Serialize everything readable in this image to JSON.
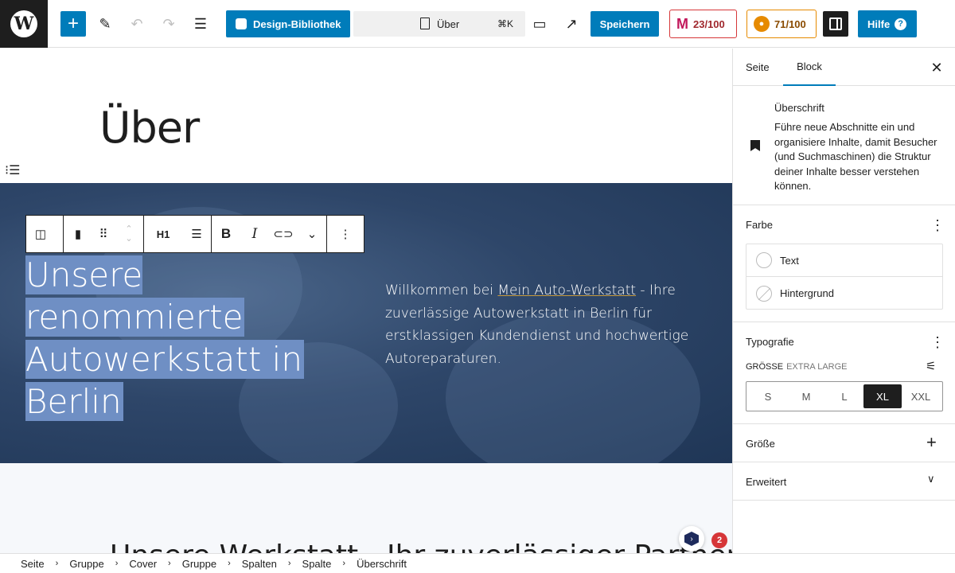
{
  "toolbar": {
    "design_library_label": "Design-Bibliothek",
    "doc_title": "Über",
    "shortcut": "⌘K",
    "save_label": "Speichern",
    "score_a": "23/100",
    "score_b": "71/100",
    "help_label": "Hilfe",
    "colors": {
      "accent": "#007cba",
      "score_a": "#d63638",
      "score_b": "#e68a00"
    }
  },
  "canvas": {
    "page_title": "Über",
    "cover": {
      "heading_lines": [
        "Unsere renommierte",
        "Autowerkstatt in",
        "Berlin"
      ],
      "text_before_link": "Willkommen bei ",
      "link_text": "Mein Auto-Werkstatt",
      "text_after_link": " - Ihre zuverlässige Autowerkstatt in Berlin für erstklassigen Kundendienst und hochwertige Autoreparaturen."
    },
    "block_toolbar": {
      "heading_level": "H1"
    },
    "next_heading": "Unsere Werkstatt - Ihr zuverlässiger Partner für",
    "notification_count": "2"
  },
  "sidebar": {
    "tabs": [
      {
        "label": "Seite"
      },
      {
        "label": "Block"
      }
    ],
    "active_tab": "Block",
    "block": {
      "name": "Überschrift",
      "description": "Führe neue Abschnitte ein und organisiere Inhalte, damit Besucher (und Suchmaschinen) die Struktur deiner Inhalte besser verstehen können."
    },
    "color_panel": {
      "title": "Farbe",
      "items": [
        {
          "label": "Text"
        },
        {
          "label": "Hintergrund"
        }
      ]
    },
    "typography_panel": {
      "title": "Typografie",
      "size_label": "Größe",
      "size_current": "Extra Large",
      "sizes": [
        "S",
        "M",
        "L",
        "XL",
        "XXL"
      ],
      "selected_size": "XL"
    },
    "dimensions_panel": {
      "title": "Größe"
    },
    "advanced_panel": {
      "title": "Erweitert"
    }
  },
  "breadcrumbs": [
    "Seite",
    "Gruppe",
    "Cover",
    "Gruppe",
    "Spalten",
    "Spalte",
    "Überschrift"
  ]
}
